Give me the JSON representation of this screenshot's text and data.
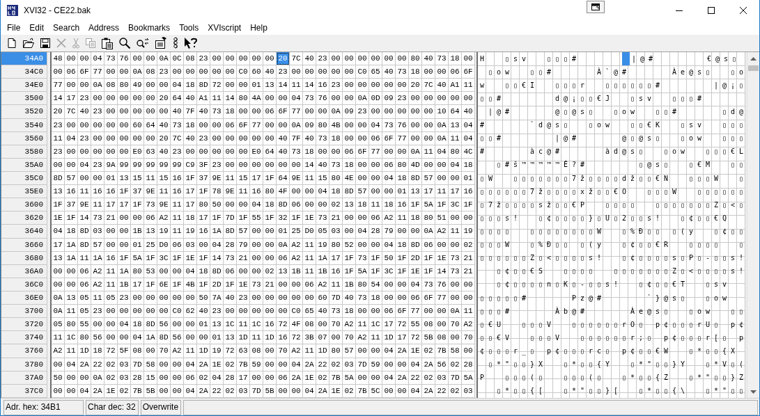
{
  "window": {
    "title": "XVI32 - CE22.bak"
  },
  "menu": [
    "File",
    "Edit",
    "Search",
    "Address",
    "Bookmarks",
    "Tools",
    "XVIscript",
    "Help"
  ],
  "toolbar": [
    {
      "kind": "new",
      "disabled": false
    },
    {
      "kind": "open",
      "disabled": false
    },
    {
      "kind": "save",
      "disabled": false
    },
    {
      "kind": "delete",
      "disabled": true
    },
    {
      "kind": "cut",
      "disabled": true
    },
    {
      "kind": "copy",
      "disabled": true
    },
    {
      "kind": "paste",
      "disabled": false
    },
    {
      "kind": "find",
      "disabled": false
    },
    {
      "kind": "replace",
      "disabled": false
    },
    {
      "kind": "settings",
      "disabled": false
    },
    {
      "kind": "script",
      "disabled": false
    },
    {
      "kind": "help",
      "disabled": false
    }
  ],
  "grid": {
    "rows": [
      {
        "address": "34A0",
        "selected": true,
        "hex": "48 00 00 04 73 76 00 00 0A 0C 08 23 00 00 00 00 00",
        "cursor_hex": "20",
        "hex_rest": "7C 40 23 00 00 00 00 00 00 80 40 73 18 00",
        "text": "H  ▯sv  ▯▯▯#     ",
        "text_rest": "|@#      €@s▯ "
      },
      {
        "address": "34C0",
        "selected": false,
        "hex": "00 06 6F 77 00 00 0A 08 23 00 00 00 00 00 C0 60 40 23 00 00 00 00 00 C0 65 40 73 18 00 00 06 6F",
        "text": " ▯ow  ▯▯#     À`@#     Àe@s▯  ▯o"
      },
      {
        "address": "34E0",
        "selected": false,
        "hex": "77 00 00 0A 08 80 49 00 00 04 18 8D 72 00 00 01 13 14 11 14 16 23 00 00 00 00 00 20 7C 40 A1 11",
        "text": "w  ▯▯€I  ▯▯▯r  ▯▯▯▯▯▯#      |@¡▯"
      },
      {
        "address": "3500",
        "selected": false,
        "hex": "14 17 23 00 00 00 00 00 20 64 40 A1 11 14 80 4A 00 00 04 73 76 00 00 0A 0D 09 23 00 00 00 00 00",
        "text": "▯▯#      d@¡▯▯€J  ▯sv  ▯▯▯#     "
      },
      {
        "address": "3520",
        "selected": false,
        "hex": "20 7C 40 23 00 00 00 00 00 40 7F 40 73 18 00 00 06 6F 77 00 00 0A 09 23 00 00 00 00 00 10 64 40",
        "text": " |@#     @▯@s▯  ▯ow  ▯▯#     ▯d@"
      },
      {
        "address": "3540",
        "selected": false,
        "hex": "23 00 00 00 00 00 60 64 40 73 18 00 00 06 6F 77 00 00 0A 09 80 4B 00 00 04 73 76 00 00 0A 13 04",
        "text": "#     `d@s▯  ▯ow  ▯▯€K  ▯sv  ▯▯▯"
      },
      {
        "address": "3560",
        "selected": false,
        "hex": "11 04 23 00 00 00 00 00 20 7C 40 23 00 00 00 00 00 40 7F 40 73 18 00 00 06 6F 77 00 00 0A 11 04",
        "text": "▯▯#      |@#     @▯@s▯  ▯ow  ▯▯▯"
      },
      {
        "address": "3580",
        "selected": false,
        "hex": "23 00 00 00 00 00 E0 63 40 23 00 00 00 00 00 E0 64 40 73 18 00 00 06 6F 77 00 00 0A 11 04 80 4C",
        "text": "#     àc@#     àd@s▯  ▯ow  ▯▯▯€L"
      },
      {
        "address": "35A0",
        "selected": false,
        "hex": "00 00 04 23 9A 99 99 99 99 99 C9 3F 23 00 00 00 00 00 00 14 40 73 18 00 00 06 80 4D 00 00 04 18",
        "text": "  ▯#š™™™™™É?#      ▯@s▯  ▯€M  ▯▯"
      },
      {
        "address": "35C0",
        "selected": false,
        "hex": "8D 57 00 00 01 13 15 11 15 16 1F 37 9E 11 15 17 1F 64 9E 11 15 80 4E 00 00 04 18 8D 57 00 00 01",
        "text": "▯W  ▯▯▯▯▯▯▯7ž▯▯▯▯dž▯▯€N  ▯▯▯W  ▯"
      },
      {
        "address": "35E0",
        "selected": false,
        "hex": "13 16 11 16 16 1F 37 9E 11 16 17 1F 78 9E 11 16 80 4F 00 00 04 18 8D 57 00 00 01 13 17 11 17 16",
        "text": "▯▯▯▯▯▯7ž▯▯▯▯xž▯▯€O  ▯▯▯W  ▯▯▯▯▯▯"
      },
      {
        "address": "3600",
        "selected": false,
        "hex": "1F 37 9E 11 17 17 1F 73 9E 11 17 80 50 00 00 04 18 8D 06 00 00 02 13 18 11 18 16 1F 5A 1F 3C 1F",
        "text": "▯7ž▯▯▯▯sž▯▯€P  ▯▯▯▯  ▯▯▯▯▯▯▯Z▯<▯"
      },
      {
        "address": "3620",
        "selected": false,
        "hex": "1E 1F 14 73 21 00 00 06 A2 11 18 17 1F 7D 1F 55 1F 32 1F 1E 73 21 00 00 06 A2 11 18 80 51 00 00",
        "text": "▯▯▯s!  ▯¢▯▯▯▯}▯U▯2▯▯s!  ▯¢▯▯€Q  "
      },
      {
        "address": "3640",
        "selected": false,
        "hex": "04 18 8D 03 00 00 1B 13 19 11 19 16 1A 8D 57 00 00 01 25 D0 05 03 00 04 28 79 00 00 0A A2 11 19",
        "text": "▯▯▯▯  ▯▯▯▯▯▯▯▯W  ▯%Ð▯▯ ▯(y  ▯¢▯▯"
      },
      {
        "address": "3660",
        "selected": false,
        "hex": "17 1A 8D 57 00 00 01 25 D0 06 03 00 04 28 79 00 00 0A A2 11 19 80 52 00 00 04 18 8D 06 00 00 02",
        "text": "▯▯▯W  ▯%Ð▯▯ ▯(y  ▯¢▯▯€R  ▯▯▯▯  ▯"
      },
      {
        "address": "3680",
        "selected": false,
        "hex": "13 1A 11 1A 16 1F 5A 1F 3C 1F 1E 1F 14 73 21 00 00 06 A2 11 1A 17 1F 73 1F 50 1F 2D 1F 1E 73 21",
        "text": "▯▯▯▯▯▯Z▯<▯▯▯▯s!  ▯¢▯▯▯▯s▯P▯-▯▯s!"
      },
      {
        "address": "36A0",
        "selected": false,
        "hex": "00 00 06 A2 11 1A 80 53 00 00 04 18 8D 06 00 00 02 13 1B 11 1B 16 1F 5A 1F 3C 1F 1E 1F 14 73 21",
        "text": "  ▯¢▯▯€S  ▯▯▯▯  ▯▯▯▯▯▯▯Z▯<▯▯▯▯s!"
      },
      {
        "address": "36C0",
        "selected": false,
        "hex": "00 00 06 A2 11 1B 17 1F 6E 1F 4B 1F 2D 1F 1E 73 21 00 00 06 A2 11 1B 80 54 00 00 04 73 76 00 00",
        "text": "  ▯¢▯▯▯▯n▯K▯-▯▯s!  ▯¢▯▯€T  ▯sv  "
      },
      {
        "address": "36E0",
        "selected": false,
        "hex": "0A 13 05 11 05 23 00 00 00 00 00 50 7A 40 23 00 00 00 00 00 60 7D 40 73 18 00 00 06 6F 77 00 00",
        "text": "▯▯▯▯▯#     Pz@#     `}@s▯  ▯ow  "
      },
      {
        "address": "3700",
        "selected": false,
        "hex": "0A 11 05 23 00 00 00 00 00 C0 62 40 23 00 00 00 00 00 C0 65 40 73 18 00 00 06 6F 77 00 00 0A 11",
        "text": "▯▯▯#     Àb@#     Àe@s▯  ▯ow  ▯▯"
      },
      {
        "address": "3720",
        "selected": false,
        "hex": "05 80 55 00 00 04 18 8D 56 00 00 01 13 1C 11 1C 16 72 4F 08 00 70 A2 11 1C 17 72 55 08 00 70 A2",
        "text": "▯€U  ▯▯▯V  ▯▯▯▯▯▯rO▯ p¢▯▯▯rU▯ p¢"
      },
      {
        "address": "3740",
        "selected": false,
        "hex": "11 1C 80 56 00 00 04 1A 8D 56 00 00 01 13 1D 11 1D 16 72 3B 07 00 70 A2 11 1D 17 72 5B 08 00 70",
        "text": "▯▯€V  ▯▯▯V  ▯▯▯▯▯▯r;▯ p¢▯▯▯r[▯ p"
      },
      {
        "address": "3760",
        "selected": false,
        "hex": "A2 11 1D 18 72 5F 08 00 70 A2 11 1D 19 72 63 08 00 70 A2 11 1D 80 57 00 00 04 2A 1E 02 7B 58 00",
        "text": "¢▯▯▯r_▯ p¢▯▯▯rc▯ p¢▯▯€W  ▯*▯▯{X "
      },
      {
        "address": "3780",
        "selected": false,
        "hex": "00 04 2A 22 02 03 7D 58 00 00 04 2A 1E 02 7B 59 00 00 04 2A 22 02 03 7D 59 00 00 04 2A 56 02 28",
        "text": " ▯*\"▯▯}X  ▯*▯▯{Y  ▯*\"▯▯}Y  ▯*V▯("
      },
      {
        "address": "37A0",
        "selected": false,
        "hex": "50 00 00 0A 02 03 28 15 00 00 06 02 04 28 17 00 00 06 2A 1E 02 7B 5A 00 00 04 2A 22 02 03 7D 5A",
        "text": "P  ▯▯▯(▯  ▯▯▯(▯  ▯*▯▯{Z  ▯*\"▯▯}Z"
      },
      {
        "address": "37C0",
        "selected": false,
        "hex": "00 00 04 2A 1E 02 7B 5B 00 00 04 2A 22 02 03 7D 5B 00 00 04 2A 1E 02 7B 5C 00 00 04 2A 22 02 03",
        "text": "  ▯*▯▯{[  ▯*\"▯▯}[  ▯*▯▯{\\  ▯*\"▯▯"
      }
    ]
  },
  "status_bar": [
    "Adr. hex: 34B1",
    "Char dec: 32",
    "Overwrite"
  ]
}
